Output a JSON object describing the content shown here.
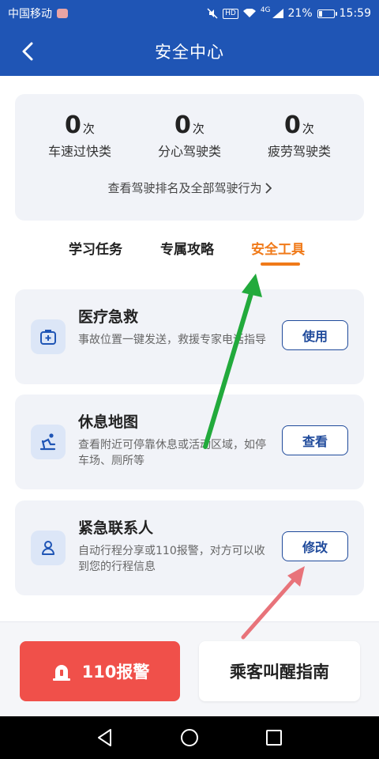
{
  "status_bar": {
    "carrier": "中国移动",
    "network": "4G",
    "battery_percent": "21%",
    "time": "15:59",
    "hd_label": "HD"
  },
  "header": {
    "title": "安全中心"
  },
  "stats": {
    "items": [
      {
        "value": "0",
        "unit": "次",
        "label": "车速过快类"
      },
      {
        "value": "0",
        "unit": "次",
        "label": "分心驾驶类"
      },
      {
        "value": "0",
        "unit": "次",
        "label": "疲劳驾驶类"
      }
    ],
    "ranking_link": "查看驾驶排名及全部驾驶行为"
  },
  "tabs": [
    {
      "label": "学习任务",
      "active": false
    },
    {
      "label": "专属攻略",
      "active": false
    },
    {
      "label": "安全工具",
      "active": true
    }
  ],
  "tools": [
    {
      "title": "医疗急救",
      "desc": "事故位置一键发送，救援专家电话指导",
      "button": "使用",
      "icon": "first-aid-kit-icon"
    },
    {
      "title": "休息地图",
      "desc": "查看附近可停靠休息或活动区域，如停车场、厕所等",
      "button": "查看",
      "icon": "resting-person-icon"
    },
    {
      "title": "紧急联系人",
      "desc": "自动行程分享或110报警，对方可以收到您的行程信息",
      "button": "修改",
      "icon": "contact-person-icon"
    }
  ],
  "bottom": {
    "alarm_label": "110报警",
    "guide_label": "乘客叫醒指南"
  },
  "colors": {
    "brand_blue": "#1f55b5",
    "active_tab": "#f07a19",
    "alarm_red": "#f0504a",
    "button_blue": "#1f4a9b",
    "annotation_green": "#22aa3c",
    "annotation_pink": "#e8737a"
  }
}
